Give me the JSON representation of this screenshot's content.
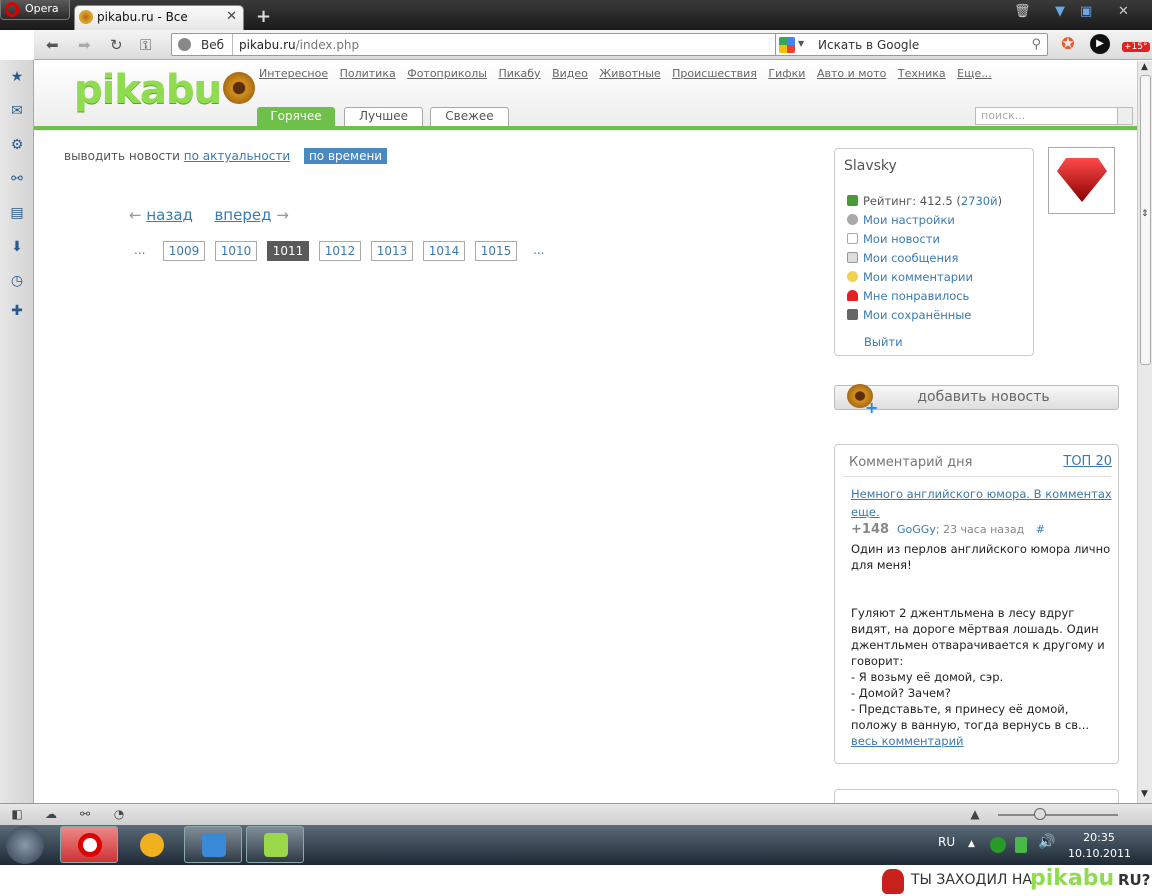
{
  "browser": {
    "menu_label": "Opera",
    "tab_title": "pikabu.ru - Все",
    "address_prefix": "Веб",
    "url_host": "pikabu.ru",
    "url_path": "/index.php",
    "search_placeholder": "Искать в Google",
    "badge": "+15°"
  },
  "site": {
    "logo": "pikabu",
    "nav": [
      "Интересное",
      "Политика",
      "Фотоприколы",
      "Пикабу",
      "Видео",
      "Животные",
      "Происшествия",
      "Гифки",
      "Авто и мото",
      "Техника",
      "Еще..."
    ],
    "tabs": [
      "Горячее",
      "Лучшее",
      "Свежее"
    ],
    "active_tab": "Горячее",
    "search_placeholder": "поиск..."
  },
  "sort": {
    "prefix": "выводить новости",
    "by_relevance": "по актуальности",
    "by_time": "по времени"
  },
  "pager": {
    "back": "назад",
    "forward": "вперед",
    "ellipsis": "...",
    "pages": [
      "1009",
      "1010",
      "1011",
      "1012",
      "1013",
      "1014",
      "1015"
    ],
    "current": "1011"
  },
  "user": {
    "name": "Slavsky",
    "rating_label": "Рейтинг: 412.5 (",
    "rating_count": "2730й",
    "rating_close": ")",
    "links": [
      "Мои настройки",
      "Мои новости",
      "Мои сообщения",
      "Мои комментарии",
      "Мне понравилось",
      "Мои сохранённые"
    ],
    "logout": "Выйти"
  },
  "add_news": "добавить новость",
  "comment_of_day": {
    "title": "Комментарий дня",
    "top": "ТОП 20",
    "post_link": "Немного английского юмора. В комментах еще.",
    "score": "+148",
    "author": "GoGGy",
    "time": "; 23 часа назад",
    "hash": "#",
    "lines": [
      "Один из перлов английского юмора лично для меня!",
      "",
      "",
      "Гуляют 2 джентльмена в лесу вдруг видят, на дороге мёртвая лошадь. Один джентльмен отварачивается к другому и говорит:",
      "- Я возьму её домой, сэр.",
      "- Домой? Зачем?"
    ],
    "last_line": "- Представьте, я принесу её домой, положу в ванную, тогда вернусь в св...",
    "more": "весь комментарий"
  },
  "taskbar": {
    "lang": "RU",
    "time": "20:35",
    "date": "10.10.2011"
  },
  "banner": {
    "text": "ТЫ ЗАХОДИЛ НА",
    "brand": "pikabu",
    "tld": "RU?"
  },
  "colors": {
    "green": "#6ec04a",
    "link": "#3a7ab0",
    "logo": "#8fdc4e"
  }
}
